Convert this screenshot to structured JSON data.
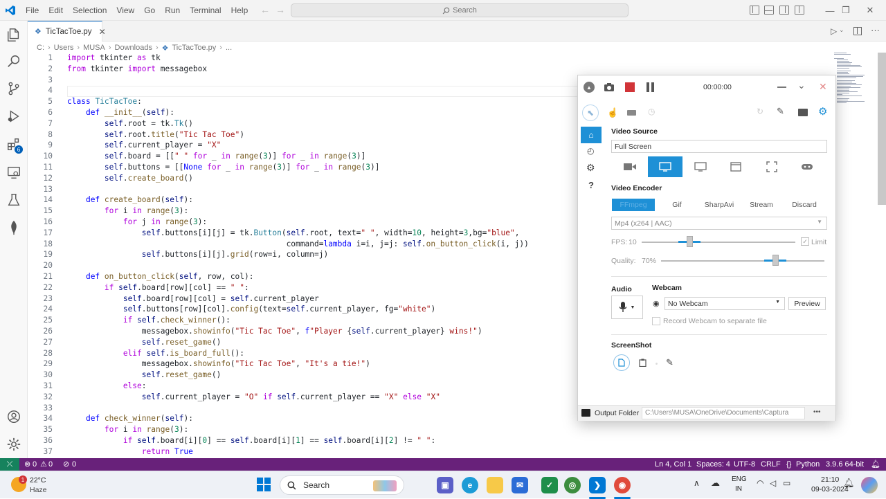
{
  "menu": [
    "File",
    "Edit",
    "Selection",
    "View",
    "Go",
    "Run",
    "Terminal",
    "Help"
  ],
  "search_label": "Search",
  "tab": {
    "filename": "TicTacToe.py"
  },
  "breadcrumb": [
    "C:",
    "Users",
    "MUSA",
    "Downloads",
    "TicTacToe.py",
    "..."
  ],
  "code_lines": [
    {
      "n": "1",
      "html": "<span class='kw2'>import</span> tkinter <span class='kw2'>as</span> tk"
    },
    {
      "n": "2",
      "html": "<span class='kw2'>from</span> tkinter <span class='kw2'>import</span> messagebox"
    },
    {
      "n": "3",
      "html": ""
    },
    {
      "n": "4",
      "html": ""
    },
    {
      "n": "5",
      "html": "<span class='kw'>class</span> <span class='cls'>TicTacToe</span>:"
    },
    {
      "n": "6",
      "html": "    <span class='kw'>def</span> <span class='fn'>__init__</span>(<span class='self'>self</span>):"
    },
    {
      "n": "7",
      "html": "        <span class='self'>self</span>.root = tk.<span class='cls'>Tk</span>()"
    },
    {
      "n": "8",
      "html": "        <span class='self'>self</span>.root.<span class='fn'>title</span>(<span class='str'>\"Tic Tac Toe\"</span>)"
    },
    {
      "n": "9",
      "html": "        <span class='self'>self</span>.current_player = <span class='str'>\"X\"</span>"
    },
    {
      "n": "10",
      "html": "        <span class='self'>self</span>.board = [[<span class='str'>\" \"</span> <span class='kw2'>for</span> _ <span class='kw2'>in</span> <span class='fn'>range</span>(<span class='num'>3</span>)] <span class='kw2'>for</span> _ <span class='kw2'>in</span> <span class='fn'>range</span>(<span class='num'>3</span>)]"
    },
    {
      "n": "11",
      "html": "        <span class='self'>self</span>.buttons = [[<span class='kw'>None</span> <span class='kw2'>for</span> _ <span class='kw2'>in</span> <span class='fn'>range</span>(<span class='num'>3</span>)] <span class='kw2'>for</span> _ <span class='kw2'>in</span> <span class='fn'>range</span>(<span class='num'>3</span>)]"
    },
    {
      "n": "12",
      "html": "        <span class='self'>self</span>.<span class='fn'>create_board</span>()"
    },
    {
      "n": "13",
      "html": ""
    },
    {
      "n": "14",
      "html": "    <span class='kw'>def</span> <span class='fn'>create_board</span>(<span class='self'>self</span>):"
    },
    {
      "n": "15",
      "html": "        <span class='kw2'>for</span> i <span class='kw2'>in</span> <span class='fn'>range</span>(<span class='num'>3</span>):"
    },
    {
      "n": "16",
      "html": "            <span class='kw2'>for</span> j <span class='kw2'>in</span> <span class='fn'>range</span>(<span class='num'>3</span>):"
    },
    {
      "n": "17",
      "html": "                <span class='self'>self</span>.buttons[i][j] = tk.<span class='cls'>Button</span>(<span class='self'>self</span>.root, text=<span class='str'>\" \"</span>, width=<span class='num'>10</span>, height=<span class='num'>3</span>,bg=<span class='str'>\"blue\"</span>,"
    },
    {
      "n": "18",
      "html": "                                               command=<span class='kw'>lambda</span> i=i, j=j: <span class='self'>self</span>.<span class='fn'>on_button_click</span>(i, j))"
    },
    {
      "n": "19",
      "html": "                <span class='self'>self</span>.buttons[i][j].<span class='fn'>grid</span>(row=i, column=j)"
    },
    {
      "n": "20",
      "html": ""
    },
    {
      "n": "21",
      "html": "    <span class='kw'>def</span> <span class='fn'>on_button_click</span>(<span class='self'>self</span>, row, col):"
    },
    {
      "n": "22",
      "html": "        <span class='kw2'>if</span> <span class='self'>self</span>.board[row][col] == <span class='str'>\" \"</span>:"
    },
    {
      "n": "23",
      "html": "            <span class='self'>self</span>.board[row][col] = <span class='self'>self</span>.current_player"
    },
    {
      "n": "24",
      "html": "            <span class='self'>self</span>.buttons[row][col].<span class='fn'>config</span>(text=<span class='self'>self</span>.current_player, fg=<span class='str'>\"white\"</span>)"
    },
    {
      "n": "25",
      "html": "            <span class='kw2'>if</span> <span class='self'>self</span>.<span class='fn'>check_winner</span>():"
    },
    {
      "n": "26",
      "html": "                messagebox.<span class='fn'>showinfo</span>(<span class='str'>\"Tic Tac Toe\"</span>, <span class='kw'>f</span><span class='str'>\"Player </span>{<span class='self'>self</span>.current_player}<span class='str'> wins!\"</span>)"
    },
    {
      "n": "27",
      "html": "                <span class='self'>self</span>.<span class='fn'>reset_game</span>()"
    },
    {
      "n": "28",
      "html": "            <span class='kw2'>elif</span> <span class='self'>self</span>.<span class='fn'>is_board_full</span>():"
    },
    {
      "n": "29",
      "html": "                messagebox.<span class='fn'>showinfo</span>(<span class='str'>\"Tic Tac Toe\"</span>, <span class='str'>\"It's a tie!\"</span>)"
    },
    {
      "n": "30",
      "html": "                <span class='self'>self</span>.<span class='fn'>reset_game</span>()"
    },
    {
      "n": "31",
      "html": "            <span class='kw2'>else</span>:"
    },
    {
      "n": "32",
      "html": "                <span class='self'>self</span>.current_player = <span class='str'>\"O\"</span> <span class='kw2'>if</span> <span class='self'>self</span>.current_player == <span class='str'>\"X\"</span> <span class='kw2'>else</span> <span class='str'>\"X\"</span>"
    },
    {
      "n": "33",
      "html": ""
    },
    {
      "n": "34",
      "html": "    <span class='kw'>def</span> <span class='fn'>check_winner</span>(<span class='self'>self</span>):"
    },
    {
      "n": "35",
      "html": "        <span class='kw2'>for</span> i <span class='kw2'>in</span> <span class='fn'>range</span>(<span class='num'>3</span>):"
    },
    {
      "n": "36",
      "html": "            <span class='kw2'>if</span> <span class='self'>self</span>.board[i][<span class='num'>0</span>] == <span class='self'>self</span>.board[i][<span class='num'>1</span>] == <span class='self'>self</span>.board[i][<span class='num'>2</span>] != <span class='str'>\" \"</span>:"
    },
    {
      "n": "37",
      "html": "                <span class='kw2'>return</span> <span class='kw'>True</span>"
    }
  ],
  "statusbar": {
    "errors": "0",
    "warnings": "0",
    "ports": "0",
    "position": "Ln 4, Col 1",
    "spaces": "Spaces: 4",
    "encoding": "UTF-8",
    "eol": "CRLF",
    "language": "Python",
    "interpreter": "3.9.6 64-bit"
  },
  "captura": {
    "timer": "00:00:00",
    "video_source_label": "Video Source",
    "video_source_value": "Full Screen",
    "video_encoder_label": "Video Encoder",
    "encoder_tabs": [
      "FFmpeg",
      "Gif",
      "SharpAvi",
      "Stream",
      "Discard"
    ],
    "codec": "Mp4 (x264 | AAC)",
    "fps_label": "FPS:",
    "fps_value": "10",
    "limit_label": "Limit",
    "quality_label": "Quality:",
    "quality_value": "70%",
    "audio_label": "Audio",
    "webcam_label": "Webcam",
    "webcam_value": "No Webcam",
    "preview_label": "Preview",
    "record_webcam_label": "Record Webcam to separate file",
    "screenshot_label": "ScreenShot",
    "output_folder_label": "Output Folder",
    "output_path": "C:\\Users\\MUSA\\OneDrive\\Documents\\Captura",
    "more": "•••"
  },
  "taskbar": {
    "weather_temp": "22°C",
    "weather_desc": "Haze",
    "weather_badge": "1",
    "search_label": "Search",
    "lang_line1": "ENG",
    "lang_line2": "IN",
    "time": "21:10",
    "date": "09-03-2024"
  },
  "colors": {
    "statusbar": "#68217a",
    "remote": "#16825d",
    "accent": "#005fb8",
    "captura_blue": "#1e90d6",
    "record_red": "#d13438"
  }
}
